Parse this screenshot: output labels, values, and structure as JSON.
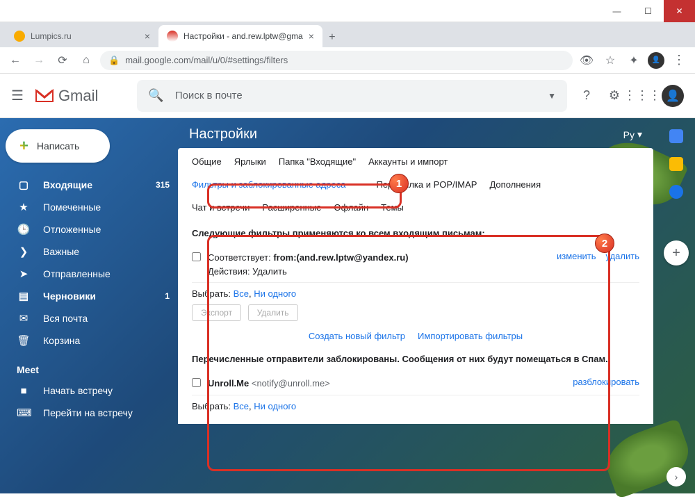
{
  "window": {
    "min": "—",
    "max": "☐",
    "close": "✕"
  },
  "tabs": {
    "t1": {
      "title": "Lumpics.ru"
    },
    "t2": {
      "title": "Настройки - and.rew.lptw@gma"
    }
  },
  "url": "mail.google.com/mail/u/0/#settings/filters",
  "gmail": {
    "brand": "Gmail",
    "search_placeholder": "Поиск в почте",
    "compose": "Написать",
    "lang": "Ру"
  },
  "nav": {
    "inbox": "Входящие",
    "inbox_count": "315",
    "starred": "Помеченные",
    "snoozed": "Отложенные",
    "important": "Важные",
    "sent": "Отправленные",
    "drafts": "Черновики",
    "drafts_count": "1",
    "all": "Вся почта",
    "trash": "Корзина",
    "meet": "Meet",
    "meet_start": "Начать встречу",
    "meet_join": "Перейти на встречу"
  },
  "settings": {
    "title": "Настройки",
    "tabs": {
      "general": "Общие",
      "labels": "Ярлыки",
      "inbox": "Папка \"Входящие\"",
      "accounts": "Аккаунты и импорт",
      "filters": "Фильтры и заблокированные адреса",
      "forwarding": "Пересылка и POP/IMAP",
      "addons": "Дополнения",
      "chat": "Чат и встречи",
      "advanced": "Расширенные",
      "offline": "Офлайн",
      "themes": "Темы"
    }
  },
  "filters": {
    "header": "Следующие фильтры применяются ко всем входящим письмам:",
    "match_label": "Соответствует:",
    "match_value": "from:(and.rew.lptw@yandex.ru)",
    "action_label": "Действия: Удалить",
    "edit": "изменить",
    "delete": "удалить",
    "select_label": "Выбрать:",
    "select_all": "Все",
    "select_none": "Ни одного",
    "export": "Экспорт",
    "delete_btn": "Удалить",
    "create": "Создать новый фильтр",
    "import": "Импортировать фильтры",
    "blocked_header": "Перечисленные отправители заблокированы. Сообщения от них будут помещаться в Спам.",
    "blocked_name": "Unroll.Me",
    "blocked_email": "<notify@unroll.me>",
    "unblock": "разблокировать"
  },
  "annotations": {
    "b1": "1",
    "b2": "2"
  }
}
